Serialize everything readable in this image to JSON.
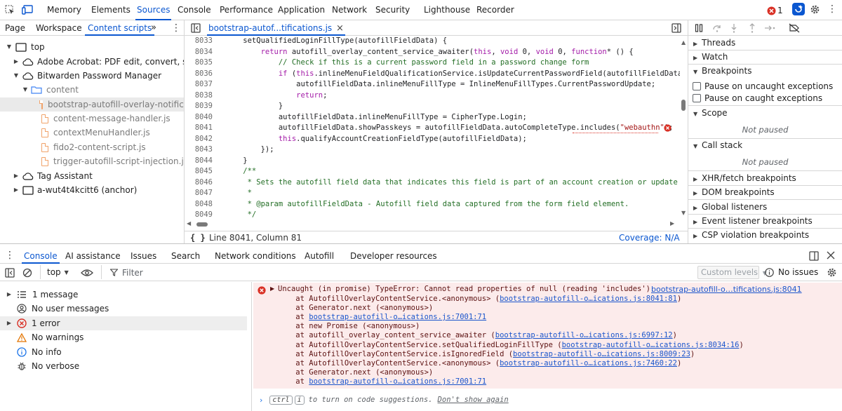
{
  "topbar": {
    "tabs": [
      "Memory",
      "Elements",
      "Sources",
      "Console",
      "Performance",
      "Application",
      "Network",
      "Security",
      "Lighthouse",
      "Recorder"
    ],
    "active_tab": "Sources",
    "error_count": "1"
  },
  "navigator": {
    "tabs": [
      "Page",
      "Workspace",
      "Content scripts"
    ],
    "active_tab": "Content scripts",
    "more": "»",
    "tree": [
      {
        "label": "top",
        "kind": "frame",
        "expanded": true
      },
      {
        "label": "Adobe Acrobat: PDF edit, convert, sign...",
        "kind": "cloud"
      },
      {
        "label": "Bitwarden Password Manager",
        "kind": "cloud",
        "expanded": true
      },
      {
        "label": "content",
        "kind": "folder",
        "expanded": true
      },
      {
        "label": "bootstrap-autofill-overlay-notifica...",
        "kind": "file",
        "selected": true
      },
      {
        "label": "content-message-handler.js",
        "kind": "file"
      },
      {
        "label": "contextMenuHandler.js",
        "kind": "file"
      },
      {
        "label": "fido2-content-script.js",
        "kind": "file"
      },
      {
        "label": "trigger-autofill-script-injection.js",
        "kind": "file"
      },
      {
        "label": "Tag Assistant",
        "kind": "cloud"
      },
      {
        "label": "a-wut4t4kcitt6 (anchor)",
        "kind": "frame"
      }
    ]
  },
  "editor": {
    "tab_label": "bootstrap-autof...tifications.js",
    "close": "×",
    "lines": [
      {
        "n": "8033",
        "code": "    setQualifiedLoginFillType(autofillFieldData) {"
      },
      {
        "n": "8034",
        "code": "        return autofill_overlay_content_service_awaiter(this, void 0, void 0, function* () {"
      },
      {
        "n": "8035",
        "code": "            // Check if this is a current password field in a password change form"
      },
      {
        "n": "8036",
        "code": "            if (this.inlineMenuFieldQualificationService.isUpdateCurrentPasswordField(autofillFieldData))"
      },
      {
        "n": "8037",
        "code": "                autofillFieldData.inlineMenuFillType = InlineMenuFillTypes.CurrentPasswordUpdate;"
      },
      {
        "n": "8038",
        "code": "                return;"
      },
      {
        "n": "8039",
        "code": "            }"
      },
      {
        "n": "8040",
        "code": "            autofillFieldData.inlineMenuFillType = CipherType.Login;"
      },
      {
        "n": "8041",
        "code": "            autofillFieldData.showPasskeys = autofillFieldData.autoCompleteType.includes(\"webauthn\");"
      },
      {
        "n": "8042",
        "code": "            this.qualifyAccountCreationFieldType(autofillFieldData);"
      },
      {
        "n": "8043",
        "code": "        });"
      },
      {
        "n": "8044",
        "code": "    }"
      },
      {
        "n": "8045",
        "code": "    /**"
      },
      {
        "n": "8046",
        "code": "     * Sets the autofill field data that indicates this field is part of an account creation or update fo"
      },
      {
        "n": "8047",
        "code": "     *"
      },
      {
        "n": "8048",
        "code": "     * @param autofillFieldData - Autofill field data captured from the form field element."
      },
      {
        "n": "8049",
        "code": "     */"
      }
    ],
    "status_brace": "{ }",
    "status_position": "Line 8041, Column 81",
    "coverage": "Coverage: N/A"
  },
  "debugger": {
    "sections": [
      {
        "label": "Threads",
        "expanded": false
      },
      {
        "label": "Watch",
        "expanded": false
      },
      {
        "label": "Breakpoints",
        "expanded": true
      }
    ],
    "pause_uncaught": "Pause on uncaught exceptions",
    "pause_caught": "Pause on caught exceptions",
    "scope": "Scope",
    "not_paused": "Not paused",
    "call_stack": "Call stack",
    "more_sections": [
      "XHR/fetch breakpoints",
      "DOM breakpoints",
      "Global listeners",
      "Event listener breakpoints",
      "CSP violation breakpoints"
    ]
  },
  "drawer": {
    "tabs": [
      "Console",
      "AI assistance",
      "Issues",
      "Search",
      "Network conditions",
      "Autofill",
      "Developer resources"
    ],
    "active_tab": "Console",
    "context": "top",
    "filter_placeholder": "Filter",
    "levels": "Custom levels",
    "issues": "No issues"
  },
  "console_sidebar": [
    {
      "label": "1 message",
      "icon": "list-icon"
    },
    {
      "label": "No user messages",
      "icon": "user-icon"
    },
    {
      "label": "1 error",
      "icon": "error-icon"
    },
    {
      "label": "No warnings",
      "icon": "warning-icon"
    },
    {
      "label": "No info",
      "icon": "info-icon"
    },
    {
      "label": "No verbose",
      "icon": "bug-icon"
    }
  ],
  "error": {
    "message": "Uncaught (in promise) TypeError: Cannot read properties of null (reading 'includes')",
    "source": "bootstrap-autofill-o…tifications.js:8041",
    "stack": [
      {
        "pre": "    at AutofillOverlayContentService.<anonymous> (",
        "link": "bootstrap-autofill-o…ications.js:8041:81",
        "post": ")"
      },
      {
        "pre": "    at Generator.next (<anonymous>)",
        "link": "",
        "post": ""
      },
      {
        "pre": "    at ",
        "link": "bootstrap-autofill-o…ications.js:7001:71",
        "post": ""
      },
      {
        "pre": "    at new Promise (<anonymous>)",
        "link": "",
        "post": ""
      },
      {
        "pre": "    at autofill_overlay_content_service_awaiter (",
        "link": "bootstrap-autofill-o…ications.js:6997:12",
        "post": ")"
      },
      {
        "pre": "    at AutofillOverlayContentService.setQualifiedLoginFillType (",
        "link": "bootstrap-autofill-o…ications.js:8034:16",
        "post": ")"
      },
      {
        "pre": "    at AutofillOverlayContentService.isIgnoredField (",
        "link": "bootstrap-autofill-o…ications.js:8009:23",
        "post": ")"
      },
      {
        "pre": "    at AutofillOverlayContentService.<anonymous> (",
        "link": "bootstrap-autofill-o…ications.js:7460:22",
        "post": ")"
      },
      {
        "pre": "    at Generator.next (<anonymous>)",
        "link": "",
        "post": ""
      },
      {
        "pre": "    at ",
        "link": "bootstrap-autofill-o…ications.js:7001:71",
        "post": ""
      }
    ]
  },
  "prompt": {
    "key1": "ctrl",
    "key2": "i",
    "text": "to turn on code suggestions.",
    "dont_show": "Don't show again"
  }
}
